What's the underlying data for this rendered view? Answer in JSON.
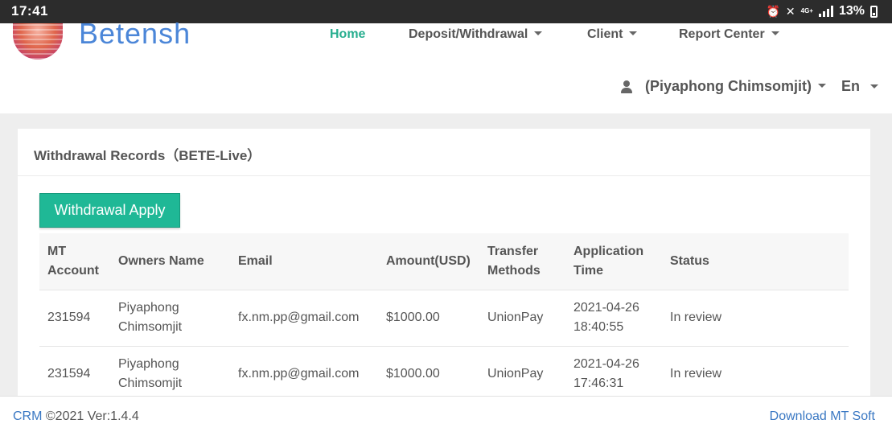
{
  "status_bar": {
    "time": "17:41",
    "network": "4G+",
    "battery": "13%"
  },
  "header": {
    "logo_text": "Betensh",
    "nav": [
      {
        "label": "Home",
        "active": true
      },
      {
        "label": "Deposit/Withdrawal",
        "dropdown": true
      },
      {
        "label": "Client",
        "dropdown": true
      },
      {
        "label": "Report Center",
        "dropdown": true
      }
    ],
    "user_name": "(Piyaphong Chimsomjit)",
    "language": "En"
  },
  "panel": {
    "title": "Withdrawal Records（BETE-Live）",
    "apply_button": "Withdrawal Apply"
  },
  "table": {
    "columns": [
      [
        "MT",
        "Account"
      ],
      [
        "Owners Name"
      ],
      [
        "Email"
      ],
      [
        "Amount(USD)"
      ],
      [
        "Transfer",
        "Methods"
      ],
      [
        "Application",
        "Time"
      ],
      [
        "Status"
      ]
    ],
    "rows": [
      {
        "account": "231594",
        "owner": [
          "Piyaphong",
          "Chimsomjit"
        ],
        "email": "fx.nm.pp@gmail.com",
        "amount": "$1000.00",
        "method": "UnionPay",
        "time": [
          "2021-04-26",
          "18:40:55"
        ],
        "status": "In review"
      },
      {
        "account": "231594",
        "owner": [
          "Piyaphong",
          "Chimsomjit"
        ],
        "email": "fx.nm.pp@gmail.com",
        "amount": "$1000.00",
        "method": "UnionPay",
        "time": [
          "2021-04-26",
          "17:46:31"
        ],
        "status": "In review"
      }
    ]
  },
  "footer": {
    "crm": "CRM",
    "version": " ©2021 Ver:1.4.4",
    "download": "Download MT Soft"
  },
  "colors": {
    "brand_blue": "#4b86d8",
    "accent_green": "#1fb896",
    "link_blue": "#3a78c3"
  }
}
